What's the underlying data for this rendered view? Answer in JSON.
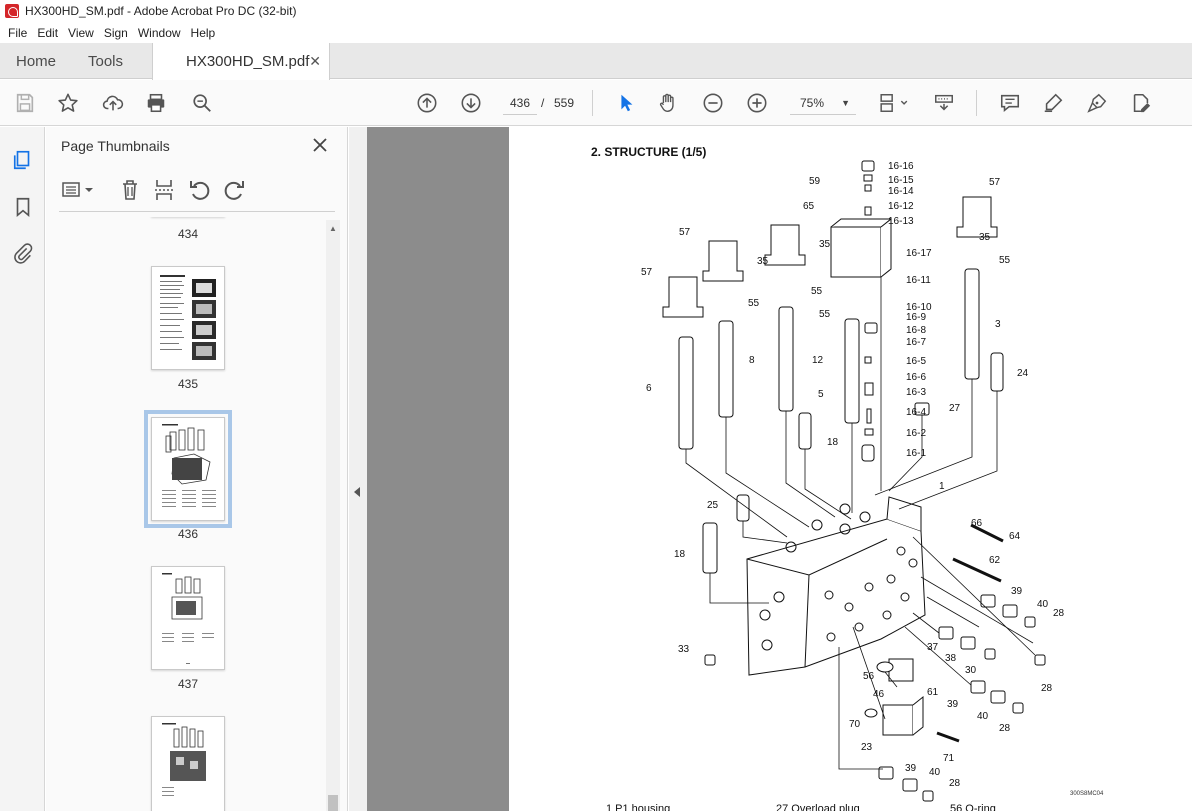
{
  "window": {
    "title": "HX300HD_SM.pdf - Adobe Acrobat Pro DC (32-bit)"
  },
  "menu": [
    "File",
    "Edit",
    "View",
    "Sign",
    "Window",
    "Help"
  ],
  "tabs": {
    "home": "Home",
    "tools": "Tools",
    "document": "HX300HD_SM.pdf"
  },
  "toolbar": {
    "current_page": "436",
    "page_separator": "/",
    "total_pages": "559",
    "zoom": "75%"
  },
  "thumbnails_panel": {
    "title": "Page Thumbnails",
    "pages": [
      {
        "label": "434"
      },
      {
        "label": "435"
      },
      {
        "label": "436",
        "selected": true
      },
      {
        "label": "437"
      }
    ]
  },
  "document": {
    "heading": "2. STRUCTURE (1/5)",
    "figure_code": "300S8MC04",
    "legend_partial": [
      "1     P1 housing",
      "27     Overload plug",
      "56     O-ring"
    ],
    "callouts": [
      "59",
      "65",
      "16-16",
      "16-15",
      "16-14",
      "16-12",
      "16-13",
      "57",
      "35",
      "57",
      "35",
      "16-17",
      "57",
      "35",
      "55",
      "55",
      "55",
      "16-11",
      "55",
      "16-10",
      "16-9",
      "16-8",
      "16-7",
      "8",
      "12",
      "3",
      "6",
      "16-5",
      "16-6",
      "24",
      "5",
      "16-3",
      "27",
      "16-4",
      "18",
      "16-2",
      "16-1",
      "1",
      "25",
      "66",
      "64",
      "18",
      "62",
      "39",
      "40",
      "28",
      "33",
      "37",
      "38",
      "30",
      "56",
      "46",
      "61",
      "28",
      "39",
      "40",
      "70",
      "23",
      "28",
      "71",
      "39",
      "40",
      "28"
    ]
  },
  "colors": {
    "accent_blue": "#1473e6",
    "doc_background": "#8c8c8c",
    "selection_outline": "#a9c7e8"
  }
}
